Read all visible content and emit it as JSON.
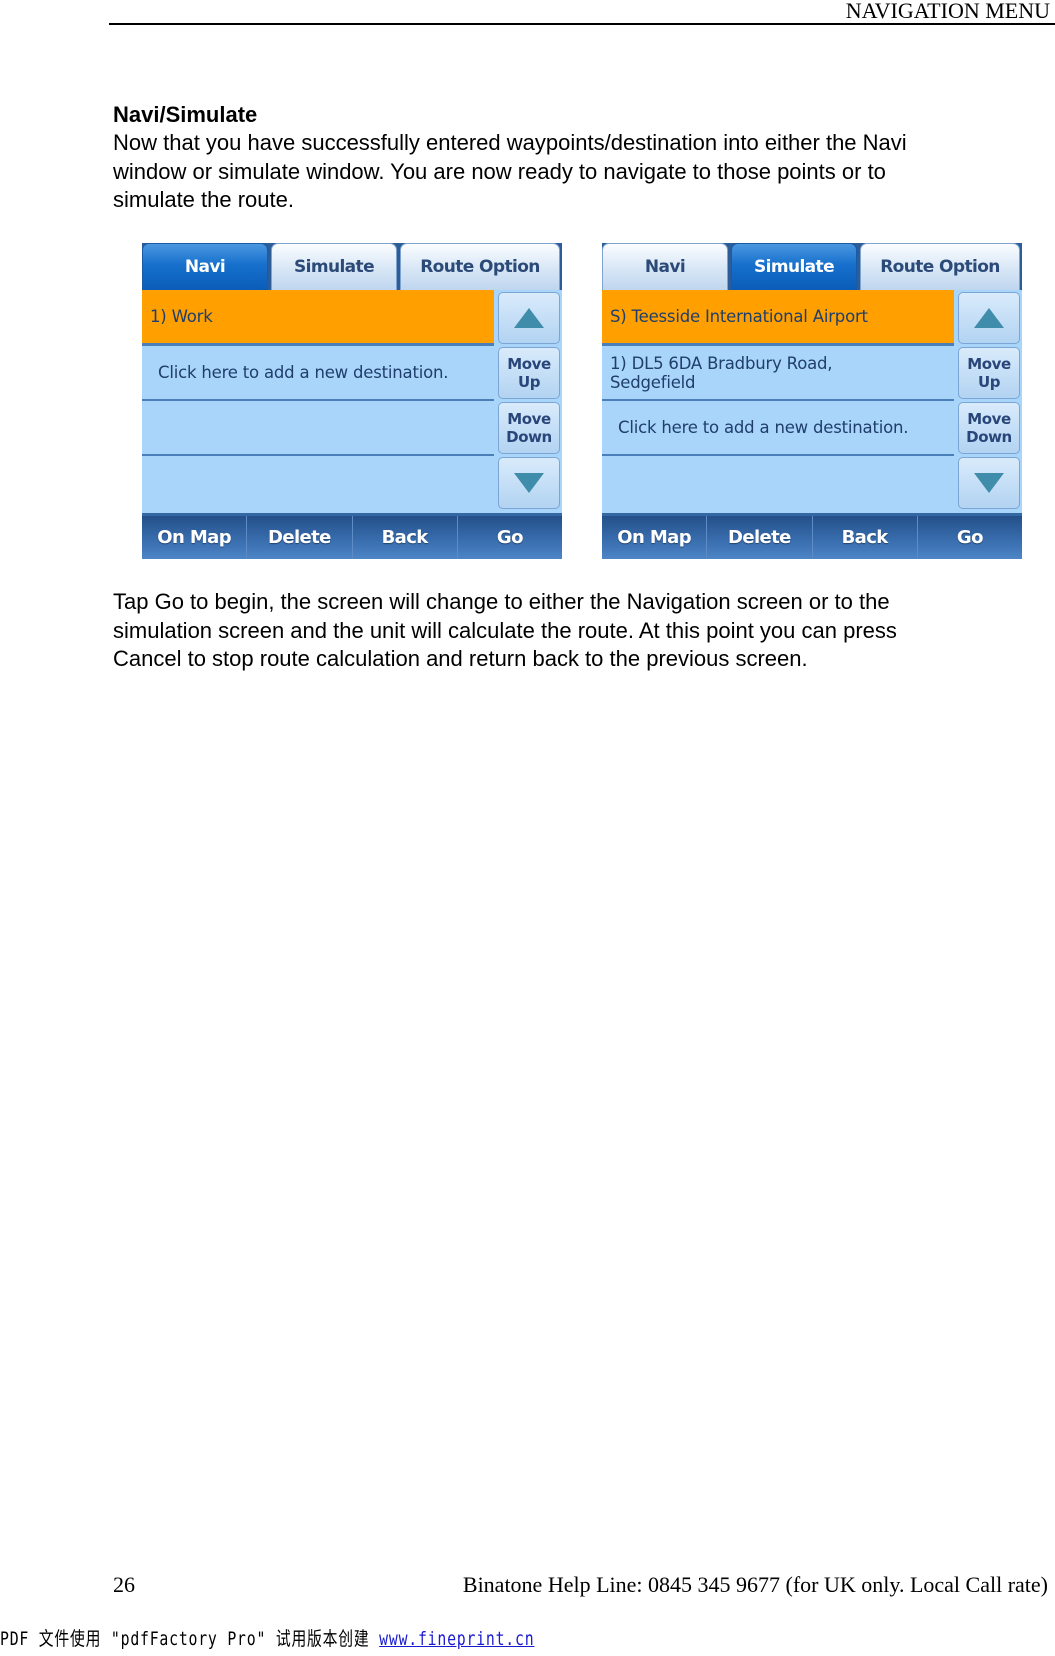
{
  "header": {
    "title": "NAVIGATION MENU"
  },
  "section": {
    "title": "Navi/Simulate",
    "intro": "Now that you have successfully entered waypoints/destination into either the Navi\nwindow or simulate window. You are now ready to navigate to those points or to\nsimulate the route.",
    "outro": "Tap Go to begin, the screen will change to either the Navigation screen or to the\nsimulation screen and the unit will calculate the route. At this point you can press\nCancel to stop route calculation and return back to the previous screen."
  },
  "panels": [
    {
      "tabs": [
        {
          "label": "Navi",
          "active": true
        },
        {
          "label": "Simulate",
          "active": false
        },
        {
          "label": "Route Option",
          "active": false
        }
      ],
      "rows": [
        {
          "text": "1)  Work",
          "selected": true
        },
        {
          "text": "Click here to add a new destination.",
          "selected": false
        },
        {
          "text": "",
          "selected": false
        },
        {
          "text": "",
          "selected": false
        }
      ],
      "side_buttons": [
        {
          "icon": "arrow-up-icon",
          "label": ""
        },
        {
          "label": "Move\nUp"
        },
        {
          "label": "Move\nDown"
        },
        {
          "icon": "arrow-down-icon",
          "label": ""
        }
      ],
      "bottom_buttons": [
        "On Map",
        "Delete",
        "Back",
        "Go"
      ]
    },
    {
      "tabs": [
        {
          "label": "Navi",
          "active": false
        },
        {
          "label": "Simulate",
          "active": true
        },
        {
          "label": "Route Option",
          "active": false
        }
      ],
      "rows": [
        {
          "text": "S) Teesside International Airport",
          "selected": true
        },
        {
          "text": "1)  DL5 6DA Bradbury Road,\n    Sedgefield",
          "selected": false
        },
        {
          "text": "Click here to add a new destination.",
          "selected": false
        },
        {
          "text": "",
          "selected": false
        }
      ],
      "side_buttons": [
        {
          "icon": "arrow-up-icon",
          "label": ""
        },
        {
          "label": "Move\nUp"
        },
        {
          "label": "Move\nDown"
        },
        {
          "icon": "arrow-down-icon",
          "label": ""
        }
      ],
      "bottom_buttons": [
        "On Map",
        "Delete",
        "Back",
        "Go"
      ]
    }
  ],
  "colors": {
    "selected_row": "#ffa000",
    "row": "#a9d5fb",
    "active_tab": "#1670cc",
    "bottom_bar": "#3a6fb0"
  },
  "footer": {
    "page_number": "26",
    "help_line": "Binatone Help Line: 0845 345 9677 (for UK only. Local Call rate)"
  },
  "watermark": {
    "text": "PDF 文件使用 \"pdfFactory Pro\" 试用版本创建 ",
    "link": "www.fineprint.cn"
  }
}
